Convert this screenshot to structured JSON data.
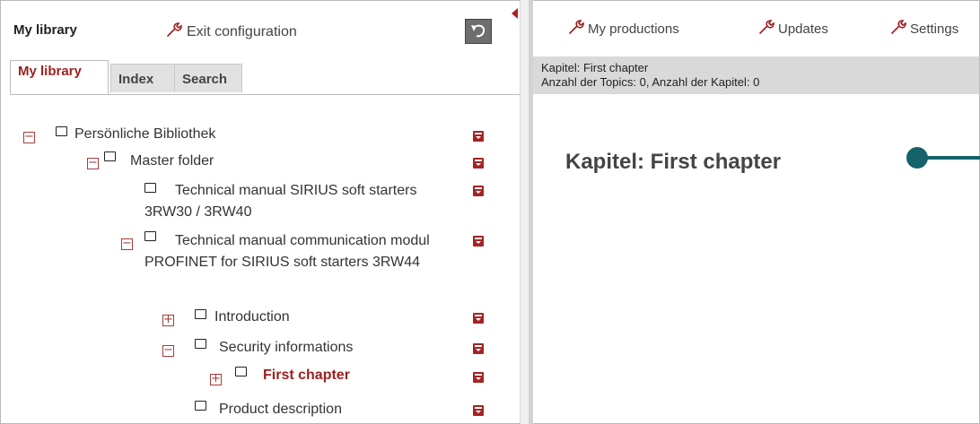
{
  "left_header": {
    "title": "My library",
    "exit_label": "Exit configuration"
  },
  "tabs": [
    {
      "label": "My library",
      "active": true
    },
    {
      "label": "Index",
      "active": false
    },
    {
      "label": "Search",
      "active": false
    }
  ],
  "tree": {
    "root": "Persönliche Bibliothek",
    "master": "Master folder",
    "manual_soft_starters": "Technical manual SIRIUS soft starters 3RW30 / 3RW40",
    "manual_profinet": "Technical manual communication modul PROFINET for SIRIUS soft starters 3RW44",
    "introduction": "Introduction",
    "security": "Security informations",
    "first_chapter": "First chapter",
    "product_description": "Product description"
  },
  "nav": {
    "my_productions": "My productions",
    "updates": "Updates",
    "settings": "Settings"
  },
  "infobar": {
    "line1": "Kapitel: First chapter",
    "line2": "Anzahl der Topics: 0, Anzahl der Kapitel: 0"
  },
  "content": {
    "title": "Kapitel: First chapter"
  },
  "colors": {
    "accent_red": "#9b1f1f",
    "menu_red": "#a32424",
    "infobar_bg": "#d9d9d9",
    "pointer_teal": "#15626a"
  },
  "icons": [
    "wrench-icon",
    "undo-icon",
    "collapse-panel-icon",
    "expand-icon",
    "collapse-icon",
    "folder-icon",
    "context-menu-icon"
  ]
}
